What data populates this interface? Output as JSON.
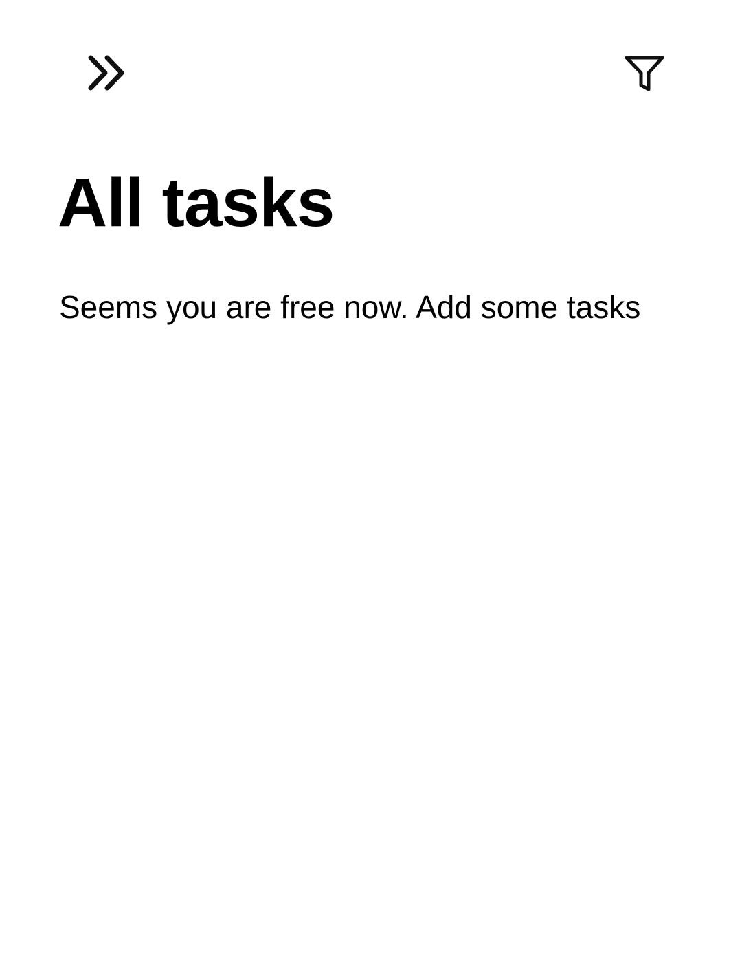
{
  "header": {
    "menu_icon": "double-chevron-right-icon",
    "filter_icon": "filter-funnel-icon"
  },
  "main": {
    "title": "All tasks",
    "empty_message": "Seems you are free now. Add some tasks"
  },
  "colors": {
    "background": "#ffffff",
    "text": "#000000",
    "icon": "#111111"
  }
}
